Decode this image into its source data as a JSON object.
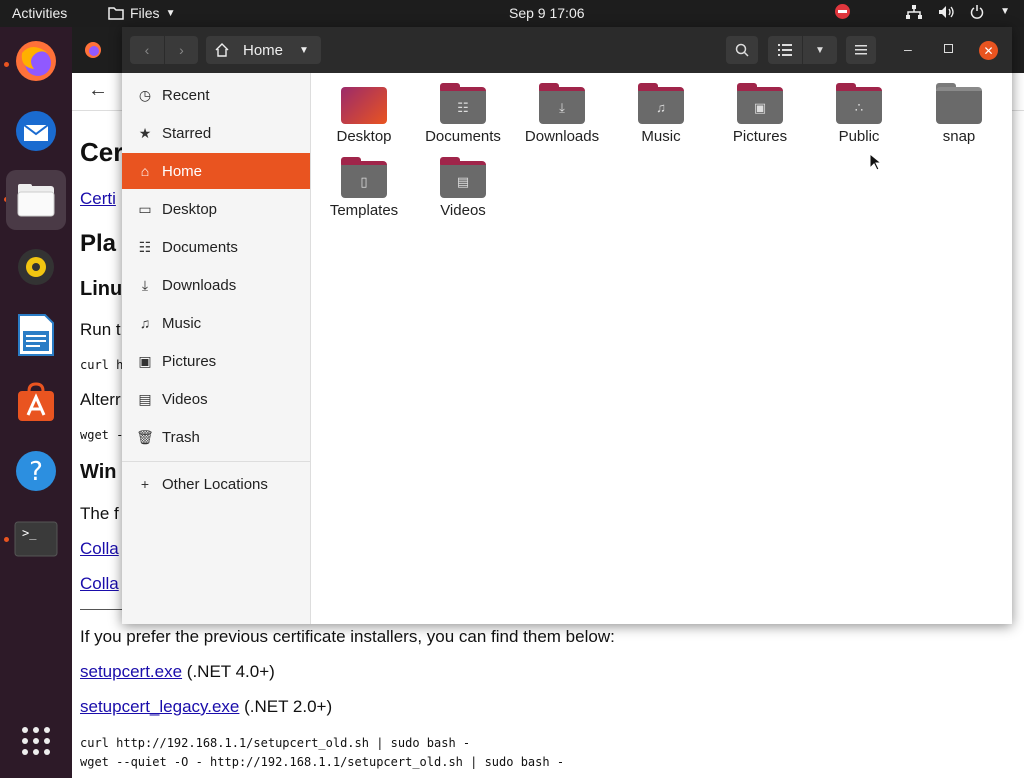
{
  "topbar": {
    "activities": "Activities",
    "app_menu": "Files",
    "clock": "Sep 9  17:06"
  },
  "files": {
    "path_label": "Home",
    "sidebar": [
      {
        "label": "Recent",
        "icon": "clock-icon"
      },
      {
        "label": "Starred",
        "icon": "star-icon"
      },
      {
        "label": "Home",
        "icon": "home-icon",
        "active": true
      },
      {
        "label": "Desktop",
        "icon": "desktop-icon"
      },
      {
        "label": "Documents",
        "icon": "document-icon"
      },
      {
        "label": "Downloads",
        "icon": "download-icon"
      },
      {
        "label": "Music",
        "icon": "music-icon"
      },
      {
        "label": "Pictures",
        "icon": "picture-icon"
      },
      {
        "label": "Videos",
        "icon": "video-icon"
      },
      {
        "label": "Trash",
        "icon": "trash-icon"
      }
    ],
    "other_locations": "Other Locations",
    "folders": [
      {
        "label": "Desktop"
      },
      {
        "label": "Documents"
      },
      {
        "label": "Downloads"
      },
      {
        "label": "Music"
      },
      {
        "label": "Pictures"
      },
      {
        "label": "Public"
      },
      {
        "label": "snap"
      },
      {
        "label": "Templates"
      },
      {
        "label": "Videos"
      }
    ]
  },
  "browser": {
    "h1_fragment": "Cer",
    "link_fragment": "Certi",
    "h2_fragment": "Pla",
    "h3_linux": "Linu",
    "run_fragment": "Run t",
    "curl_fragment": "curl h",
    "alt_fragment": "Alterr",
    "wget_fragment": "wget -",
    "h3_win": "Win",
    "the_fragment": "The f",
    "colla1": "Colla",
    "colla2": "Colla",
    "prev_text": "If you prefer the previous certificate installers, you can find them below:",
    "setup1_link": "setupcert.exe",
    "setup1_note": " (.NET 4.0+)",
    "setup2_link": "setupcert_legacy.exe",
    "setup2_note": " (.NET 2.0+)",
    "cmd1": "curl http://192.168.1.1/setupcert_old.sh | sudo bash -",
    "cmd2": "wget --quiet -O - http://192.168.1.1/setupcert_old.sh | sudo bash -"
  },
  "colors": {
    "accent": "#e95420",
    "folder_accent": "#a0254a"
  }
}
